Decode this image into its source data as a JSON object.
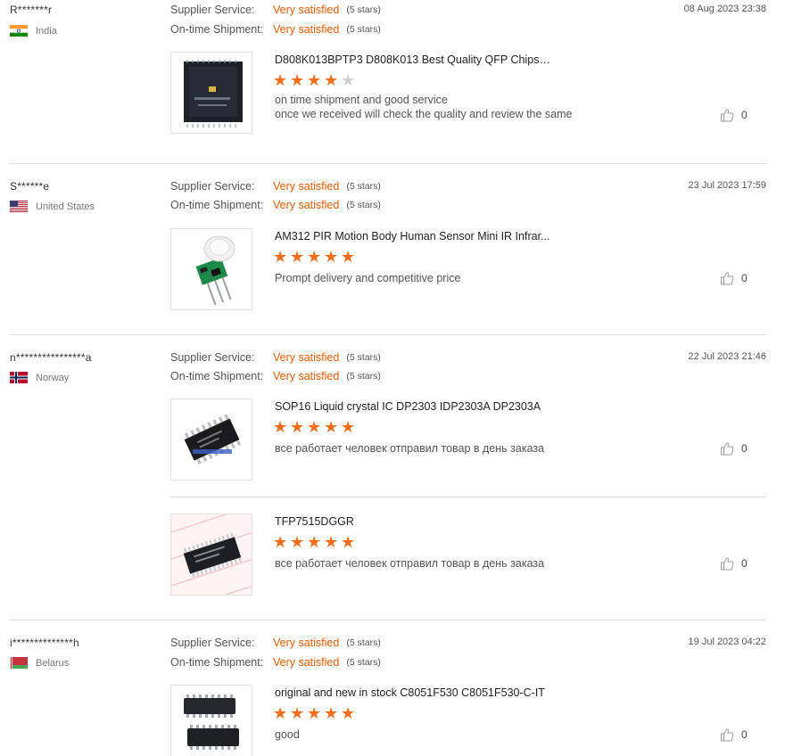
{
  "reviews": [
    {
      "buyer": "R*******r",
      "country": "India",
      "date": "08 Aug 2023 23:38",
      "supplier_label": "Supplier Service:",
      "supplier_value": "Very satisfied",
      "supplier_stars": "(5 stars)",
      "shipment_label": "On-time Shipment:",
      "shipment_value": "Very satisfied",
      "shipment_stars": "(5 stars)",
      "products": [
        {
          "title": "D808K013BPTP3 D808K013 Best Quality QFP Chipse...",
          "rating": 4,
          "comment_lines": [
            "on time shipment and good service",
            "once we received will check the quality and review the same"
          ],
          "likes": "0"
        }
      ]
    },
    {
      "buyer": "S******e",
      "country": "United States",
      "date": "23 Jul 2023 17:59",
      "supplier_label": "Supplier Service:",
      "supplier_value": "Very satisfied",
      "supplier_stars": "(5 stars)",
      "shipment_label": "On-time Shipment:",
      "shipment_value": "Very satisfied",
      "shipment_stars": "(5 stars)",
      "products": [
        {
          "title": "AM312 PIR Motion Body Human Sensor Mini IR Infrar...",
          "rating": 5,
          "comment_lines": [
            "Prompt delivery and competitive price"
          ],
          "likes": "0"
        }
      ]
    },
    {
      "buyer": "n****************a",
      "country": "Norway",
      "date": "22 Jul 2023 21:46",
      "supplier_label": "Supplier Service:",
      "supplier_value": "Very satisfied",
      "supplier_stars": "(5 stars)",
      "shipment_label": "On-time Shipment:",
      "shipment_value": "Very satisfied",
      "shipment_stars": "(5 stars)",
      "products": [
        {
          "title": "SOP16 Liquid crystal IC DP2303 IDP2303A DP2303A",
          "rating": 5,
          "comment_lines": [
            "все работает человек отправил товар в день заказа"
          ],
          "likes": "0"
        },
        {
          "title": "TFP7515DGGR",
          "rating": 5,
          "comment_lines": [
            "все работает человек отправил товар в день заказа"
          ],
          "likes": "0"
        }
      ]
    },
    {
      "buyer": "i**************h",
      "country": "Belarus",
      "date": "19 Jul 2023 04:22",
      "supplier_label": "Supplier Service:",
      "supplier_value": "Very satisfied",
      "supplier_stars": "(5 stars)",
      "shipment_label": "On-time Shipment:",
      "shipment_value": "Very satisfied",
      "shipment_stars": "(5 stars)",
      "products": [
        {
          "title": "original and new in stock C8051F530 C8051F530-C-IT",
          "rating": 5,
          "comment_lines": [
            "good"
          ],
          "likes": "0"
        }
      ]
    }
  ],
  "colors": {
    "accent": "#f05a00",
    "star": "#f36d1b",
    "star_empty": "#cfcfcf"
  },
  "icons": {
    "like": "thumbs-up-icon",
    "star": "star-icon"
  }
}
